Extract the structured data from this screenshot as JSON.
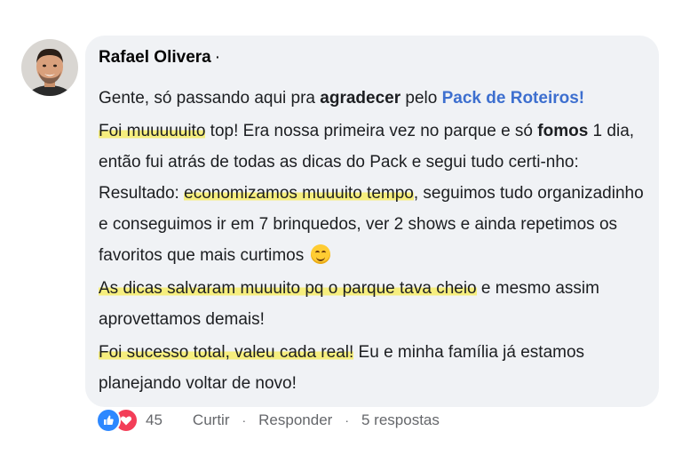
{
  "comment": {
    "author": "Rafael Olivera",
    "author_dot": "·",
    "p1": {
      "before": "Gente, só passando aqui pra ",
      "bold": "agradecer",
      "middle": " pelo ",
      "link": "Pack de Roteiros!"
    },
    "p2": {
      "hl1": "Foi muuuuuito",
      "t1": " top! Era nossa primeira vez no parque e só ",
      "bold1": "fomos",
      "t2": " 1 dia, então fui atrás de todas as dicas do Pack e segui tudo certi-nho: Resultado: ",
      "hl2": "economizamos muuuito tempo",
      "t3": ", seguimos tudo organizadinho e conseguimos ir em 7 brinquedos, ver 2 shows e ainda repetimos os favoritos que mais curtimos"
    },
    "p3": {
      "hl": "As dicas salvaram muuuito pq o parque tava cheio",
      "t": " e mesmo assim aprovettamos demais!"
    },
    "p4": {
      "hl": "Foi sucesso total, valeu cada real!",
      "t": " Eu e minha família já estamos planejando voltar de novo!"
    }
  },
  "footer": {
    "reactions": [
      "like-icon",
      "love-icon"
    ],
    "reaction_count": "45",
    "like_label": "Curtir",
    "reply_label": "Responder",
    "replies_label": "5 respostas",
    "separator": "·"
  },
  "colors": {
    "bubble": "#f0f2f5",
    "highlight": "#f6ee7e",
    "link": "#3d6fcf",
    "like": "#2d88ff",
    "love": "#f33e58"
  }
}
